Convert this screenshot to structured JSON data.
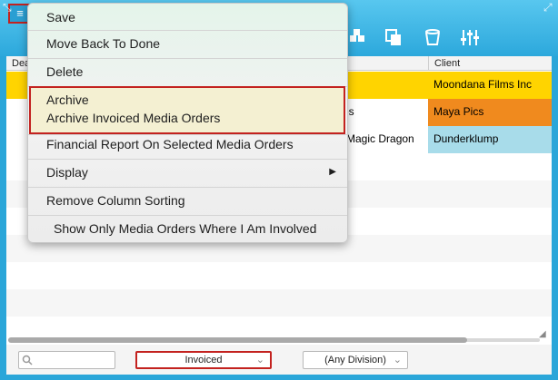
{
  "toolbar": {
    "menu_icon": "menu-icon",
    "icons": [
      "cubes-icon",
      "copy-icon",
      "trash-icon",
      "sliders-icon"
    ]
  },
  "table": {
    "headers": [
      "Dea",
      "Client"
    ],
    "rows": [
      {
        "title_fragment": "",
        "client": "Moondana Films Inc",
        "client_color": "#ffd400",
        "row_color": "#ffd400"
      },
      {
        "title_fragment": "es",
        "client": "Maya Pics",
        "client_color": "#f08a1e",
        "row_color": "#ffffff"
      },
      {
        "title_fragment": "e Magic Dragon",
        "client": "Dunderklump",
        "client_color": "#a8dcea",
        "row_color": "#ffffff"
      }
    ]
  },
  "menu": {
    "save": "Save",
    "move_back": "Move Back To Done",
    "delete": "Delete",
    "archive": "Archive",
    "archive_invoiced": "Archive Invoiced Media Orders",
    "financial_report": "Financial Report On Selected Media Orders",
    "display": "Display",
    "display_arrow": "▶",
    "remove_sorting": "Remove Column Sorting",
    "show_only": "Show Only Media Orders Where I Am Involved"
  },
  "bottom": {
    "search_placeholder": "",
    "status_select": "Invoiced",
    "division_select": "(Any Division)"
  },
  "colors": {
    "accent": "#2aa6d9",
    "highlight_border": "#c3221f"
  }
}
